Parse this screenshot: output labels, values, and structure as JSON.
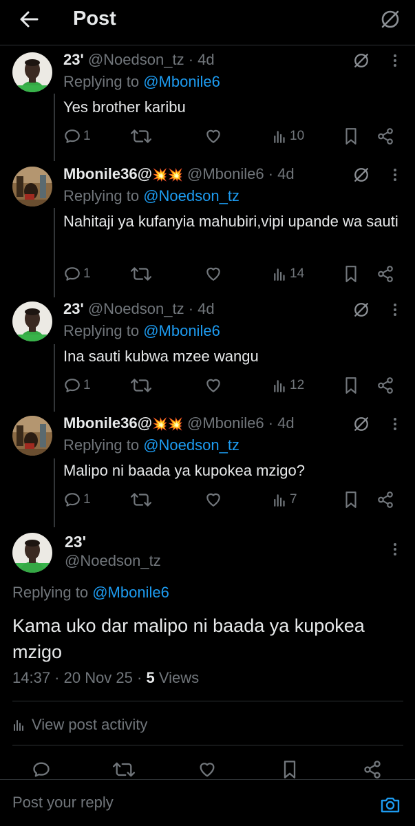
{
  "header": {
    "title": "Post"
  },
  "replies": [
    {
      "name": "23'",
      "emoji": "",
      "handle": "@Noedson_tz",
      "time": "4d",
      "replying_prefix": "Replying to ",
      "replying_to": "@Mbonile6",
      "text": "Yes brother karibu",
      "replies": "1",
      "retweets": "",
      "likes": "",
      "views": "10"
    },
    {
      "name": "Mbonile36@",
      "emoji": "💥💥",
      "handle": "@Mbonile6",
      "time": "4d",
      "replying_prefix": "Replying to ",
      "replying_to": "@Noedson_tz",
      "text": "Nahitaji ya kufanyia mahubiri,vipi upande wa sauti",
      "replies": "1",
      "retweets": "",
      "likes": "",
      "views": "14"
    },
    {
      "name": "23'",
      "emoji": "",
      "handle": "@Noedson_tz",
      "time": "4d",
      "replying_prefix": "Replying to ",
      "replying_to": "@Mbonile6",
      "text": "Ina sauti kubwa mzee wangu",
      "replies": "1",
      "retweets": "",
      "likes": "",
      "views": "12"
    },
    {
      "name": "Mbonile36@",
      "emoji": "💥💥",
      "handle": "@Mbonile6",
      "time": "4d",
      "replying_prefix": "Replying to ",
      "replying_to": "@Noedson_tz",
      "text": "Malipo ni baada ya kupokea mzigo?",
      "replies": "1",
      "retweets": "",
      "likes": "",
      "views": "7"
    }
  ],
  "main_post": {
    "name": "23'",
    "handle": "@Noedson_tz",
    "replying_prefix": "Replying to ",
    "replying_to": "@Mbonile6",
    "text": "Kama uko dar malipo ni baada ya kupokea mzigo",
    "timestamp": "14:37 · 20 Nov 25 · ",
    "views_count": "5",
    "views_label": " Views"
  },
  "activity_label": "View post activity",
  "reply_bar": {
    "placeholder": "Post your reply"
  },
  "colors": {
    "accent": "#1d9bf0",
    "muted": "#71767b",
    "text": "#e7e9ea",
    "bg": "#000000"
  }
}
